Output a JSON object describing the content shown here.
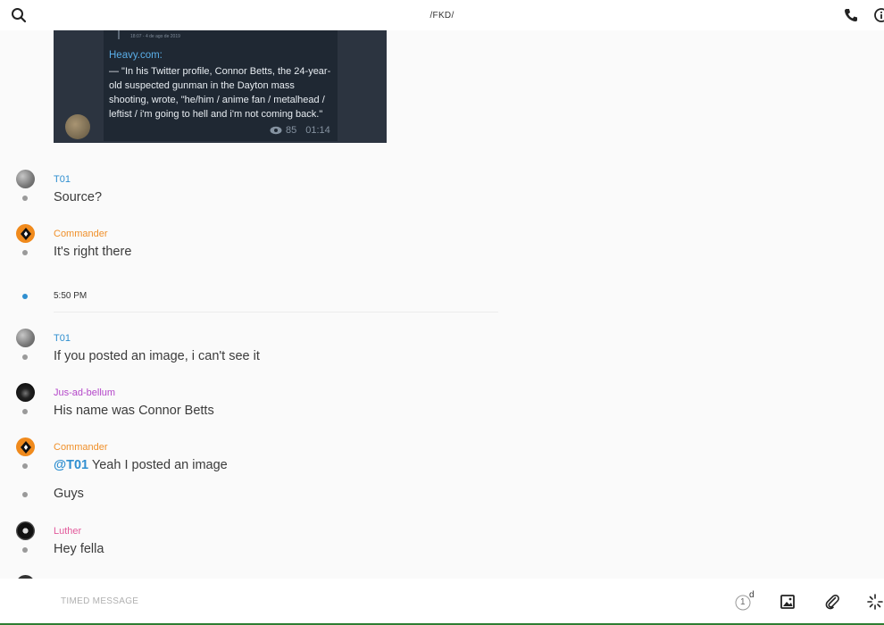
{
  "header": {
    "title": "/FKD/"
  },
  "embed": {
    "meta": "18:07 - 4 de ago de 2019",
    "source": "Heavy.com:",
    "quote": "— \"In his Twitter profile, Connor Betts, the 24-year-old suspected gunman in the Dayton mass shooting, wrote, \"he/him / anime fan / metalhead / leftist / i'm going to hell and i'm not coming back.\"",
    "views": "85",
    "time": "01:14"
  },
  "messages": [
    {
      "user": "T01",
      "text": "Source?"
    },
    {
      "user": "Commander",
      "text": "It's right there"
    },
    {
      "user": "T01",
      "text": "If you posted an image, i can't see it"
    },
    {
      "user": "Jus-ad-bellum",
      "text": "His name was Connor Betts"
    },
    {
      "user": "Commander",
      "mention": "@T01",
      "text": " Yeah I posted an image"
    },
    {
      "text": "Guys"
    },
    {
      "user": "Luther",
      "text": "Hey fella"
    }
  ],
  "separator": {
    "time": "5:50 PM"
  },
  "composer": {
    "placeholder": "TIMED MESSAGE",
    "timer_value": "1",
    "timer_unit": "d"
  },
  "colors": {
    "accent": "#2f8fd0",
    "commander": "#f0902a",
    "jus": "#b447c9",
    "luther": "#e25a9b"
  }
}
